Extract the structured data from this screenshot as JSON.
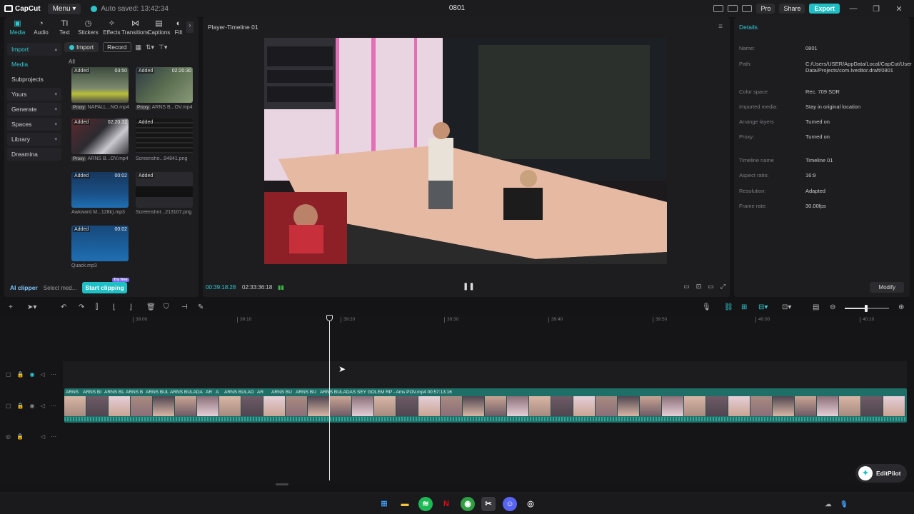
{
  "titlebar": {
    "app_name": "CapCut",
    "menu_label": "Menu",
    "autosave": "Auto saved: 13:42:34",
    "project_title": "0801",
    "pro_label": "Pro",
    "share_label": "Share",
    "export_label": "Export"
  },
  "tabs": [
    {
      "label": "Media",
      "icon": "media-icon"
    },
    {
      "label": "Audio",
      "icon": "audio-icon"
    },
    {
      "label": "Text",
      "icon": "text-icon"
    },
    {
      "label": "Stickers",
      "icon": "stickers-icon"
    },
    {
      "label": "Effects",
      "icon": "effects-icon"
    },
    {
      "label": "Transitions",
      "icon": "transitions-icon"
    },
    {
      "label": "Captions",
      "icon": "captions-icon"
    },
    {
      "label": "Filt",
      "icon": "filters-icon"
    }
  ],
  "sidenav": {
    "import": "Import",
    "media": "Media",
    "subprojects": "Subprojects",
    "yours": "Yours",
    "generate": "Generate",
    "spaces": "Spaces",
    "library": "Library",
    "dreamina": "Dreamina"
  },
  "media_toolbar": {
    "import": "Import",
    "record": "Record",
    "all": "All"
  },
  "media_items": [
    {
      "added": "Added",
      "duration": "03:50",
      "proxy": "Proxy",
      "name": "NAPALL...NO.mp4"
    },
    {
      "added": "Added",
      "duration": "02:20:30",
      "proxy": "Proxy",
      "name": "ARNS B...OV.mp4"
    },
    {
      "added": "Added",
      "duration": "02:20:32",
      "proxy": "Proxy",
      "name": "ARNS B...OV.mp4"
    },
    {
      "added": "Added",
      "duration": "",
      "proxy": "",
      "name": "Screensho...94841.png"
    },
    {
      "added": "Added",
      "duration": "00:02",
      "proxy": "",
      "name": "Awkward M...128k).mp3"
    },
    {
      "added": "Added",
      "duration": "",
      "proxy": "",
      "name": "Screenshot...213107.png"
    },
    {
      "added": "Added",
      "duration": "00:02",
      "proxy": "",
      "name": "Quack.mp3"
    }
  ],
  "left_footer": {
    "ai_clipper": "AI clipper",
    "select_media": "Select med...",
    "start_clipping": "Start clipping",
    "try_badge": "Try free"
  },
  "player": {
    "title": "Player-Timeline 01",
    "current_time": "00:39:18:28",
    "total_time": "02:33:36:18"
  },
  "details": {
    "title": "Details",
    "rows": [
      {
        "key": "Name:",
        "value": "0801"
      },
      {
        "key": "Path:",
        "value": "C:/Users/USER/AppData/Local/CapCut/User Data/Projects/com.lveditor.draft/0801"
      },
      {
        "key": "Color space",
        "value": "Rec. 709 SDR"
      },
      {
        "key": "Imported media:",
        "value": "Stay in original location"
      },
      {
        "key": "Arrange layers",
        "value": "Turned on"
      },
      {
        "key": "Proxy:",
        "value": "Turned on"
      },
      {
        "key": "Timeline name",
        "value": "Timeline 01"
      },
      {
        "key": "Aspect ratio:",
        "value": "16:9"
      },
      {
        "key": "Resolution:",
        "value": "Adapted"
      },
      {
        "key": "Frame rate:",
        "value": "30.00fps"
      }
    ],
    "modify": "Modify"
  },
  "ruler_ticks": [
    "39:00",
    "39:10",
    "39:20",
    "39:30",
    "39:40",
    "39:50",
    "40:00",
    "40:10"
  ],
  "clips": [
    {
      "name": "ARNS"
    },
    {
      "name": "ARNS BI"
    },
    {
      "name": "ARNS BUI"
    },
    {
      "name": "ARNS B"
    },
    {
      "name": "ARNS BUL"
    },
    {
      "name": "ARNS BULADA"
    },
    {
      "name": "AR"
    },
    {
      "name": "A"
    },
    {
      "name": "ARNS BULAD"
    },
    {
      "name": "AR"
    },
    {
      "name": "ARNS BU"
    },
    {
      "name": "ARNS BU"
    },
    {
      "name": "ARNS BULADAS SEY GOLEM RP - Ams POV.mp4   00:57:13:16"
    }
  ],
  "editpilot": "EditPilot",
  "colors": {
    "accent": "#1fbfc6",
    "clip": "#1e6f67",
    "panel": "#1d1d20"
  }
}
